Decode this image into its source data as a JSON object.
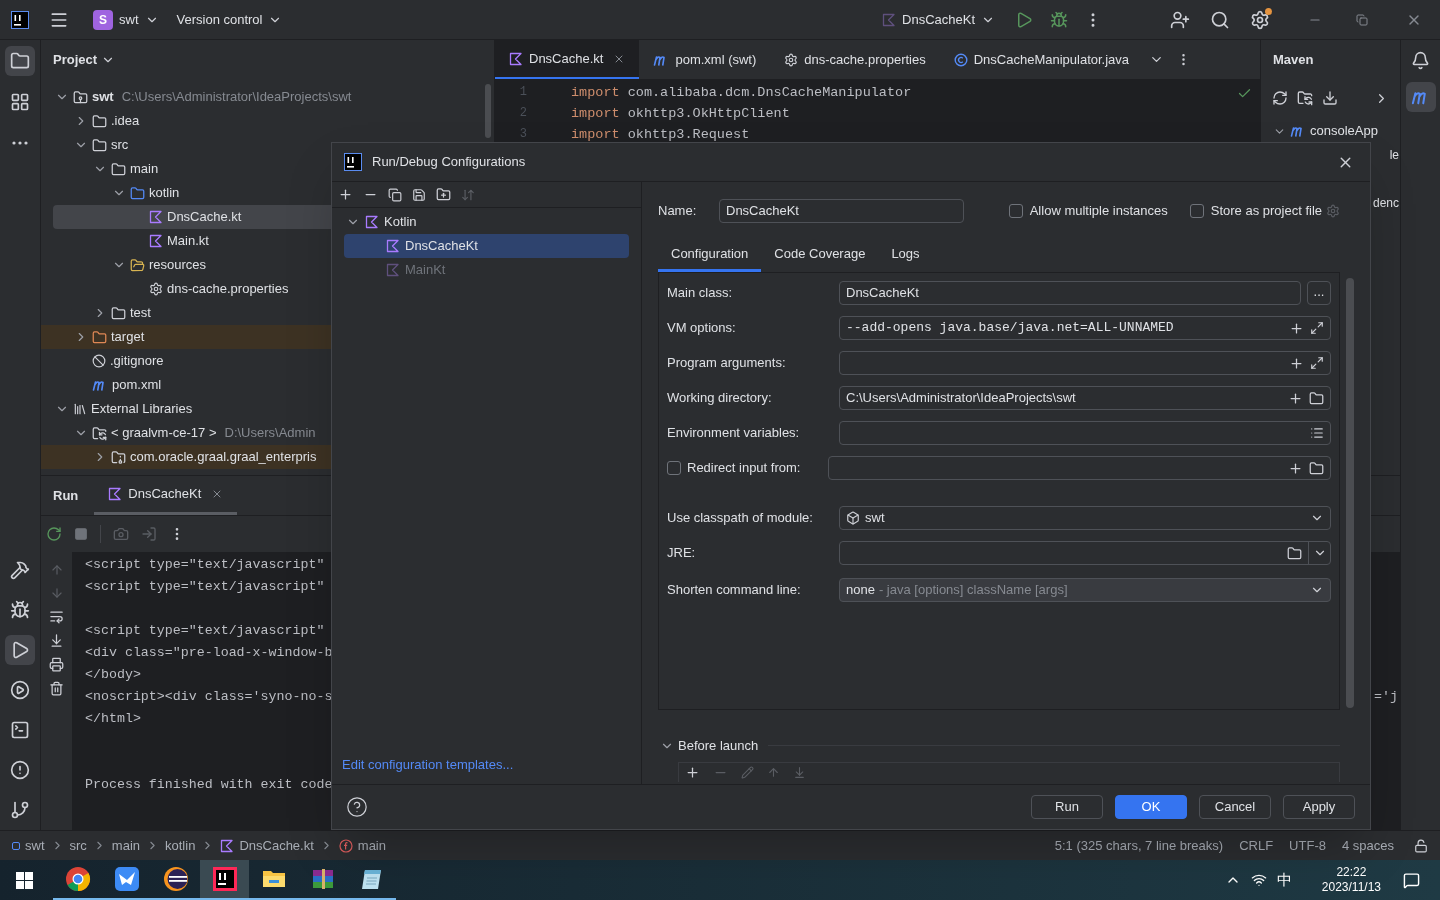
{
  "title_bar": {
    "project_initial": "S",
    "project": "swt",
    "vcs": "Version control",
    "run_config": "DnsCacheKt"
  },
  "left_toolbar": {
    "top": [
      {
        "kind": "project",
        "selected": true
      },
      {
        "kind": "structure",
        "selected": false
      },
      {
        "kind": "more",
        "selected": false
      }
    ],
    "bottom": [
      {
        "kind": "build",
        "selected": false
      },
      {
        "kind": "debug",
        "selected": false
      },
      {
        "kind": "run",
        "selected": true
      },
      {
        "kind": "services",
        "selected": false
      },
      {
        "kind": "terminal",
        "selected": false
      },
      {
        "kind": "problems",
        "selected": false
      },
      {
        "kind": "git",
        "selected": false
      }
    ]
  },
  "project": {
    "title": "Project",
    "tree": [
      {
        "label": "swt",
        "detail": "C:\\Users\\Administrator\\IdeaProjects\\swt",
        "kind": "project",
        "expanded": true,
        "selected": false,
        "highlighted": false,
        "children": [
          {
            "label": ".idea",
            "kind": "folder",
            "expanded": false,
            "selected": false,
            "highlighted": false
          },
          {
            "label": "src",
            "kind": "folder",
            "expanded": true,
            "selected": false,
            "highlighted": false,
            "children": [
              {
                "label": "main",
                "kind": "folder",
                "expanded": true,
                "selected": false,
                "highlighted": false,
                "children": [
                  {
                    "label": "kotlin",
                    "kind": "source",
                    "expanded": true,
                    "selected": false,
                    "highlighted": false,
                    "children": [
                      {
                        "label": "DnsCache.kt",
                        "kind": "kotlin",
                        "selected": true,
                        "highlighted": false
                      },
                      {
                        "label": "Main.kt",
                        "kind": "kotlin",
                        "selected": false,
                        "highlighted": false
                      }
                    ]
                  },
                  {
                    "label": "resources",
                    "kind": "resources",
                    "expanded": true,
                    "selected": false,
                    "highlighted": false,
                    "children": [
                      {
                        "label": "dns-cache.properties",
                        "kind": "properties",
                        "selected": false,
                        "highlighted": false
                      }
                    ]
                  }
                ]
              },
              {
                "label": "test",
                "kind": "folder",
                "expanded": false,
                "selected": false,
                "highlighted": false
              }
            ]
          },
          {
            "label": "target",
            "kind": "excluded",
            "expanded": false,
            "selected": false,
            "highlighted": true
          },
          {
            "label": ".gitignore",
            "kind": "ignore",
            "selected": false,
            "highlighted": false
          },
          {
            "label": "pom.xml",
            "kind": "maven",
            "selected": false,
            "highlighted": false
          }
        ]
      },
      {
        "label": "External Libraries",
        "kind": "libraries",
        "expanded": true,
        "selected": false,
        "highlighted": false,
        "children": [
          {
            "label": "< graalvm-ce-17 >",
            "detail": "D:\\Users\\Admin",
            "kind": "sdk",
            "expanded": true,
            "selected": false,
            "highlighted": false,
            "children": [
              {
                "label": "com.oracle.graal.graal_enterpris",
                "kind": "jar",
                "expanded": false,
                "selected": false,
                "highlighted": true
              }
            ]
          }
        ]
      }
    ]
  },
  "editor": {
    "tabs": [
      {
        "label": "DnsCache.kt",
        "kind": "kotlin",
        "selected": true
      },
      {
        "label": "pom.xml (swt)",
        "kind": "maven",
        "selected": false
      },
      {
        "label": "dns-cache.properties",
        "kind": "properties",
        "selected": false
      },
      {
        "label": "DnsCacheManipulator.java",
        "kind": "class",
        "selected": false
      }
    ],
    "lines": [
      {
        "number": "1",
        "keyword": "import",
        "text": "com.alibaba.dcm.DnsCacheManipulator"
      },
      {
        "number": "2",
        "keyword": "import",
        "text": "okhttp3.OkHttpClient"
      },
      {
        "number": "3",
        "keyword": "import",
        "text": "okhttp3.Request"
      }
    ]
  },
  "maven": {
    "title": "Maven",
    "tree": [
      {
        "label": "consoleApp",
        "expanded": true
      }
    ],
    "fragments": [
      "le",
      "denc"
    ]
  },
  "run_panel": {
    "title": "Run",
    "tabs": [
      {
        "label": "DnsCacheKt",
        "selected": true
      }
    ],
    "console": [
      {
        "kind": "line",
        "text": "<script type=\"text/javascript\""
      },
      {
        "kind": "line",
        "text": "<script type=\"text/javascript\""
      },
      {
        "kind": "blank"
      },
      {
        "kind": "line",
        "text": "<script type=\"text/javascript\""
      },
      {
        "kind": "line",
        "text": "<div class=\"pre-load-x-window-b"
      },
      {
        "kind": "line",
        "text": "</body>"
      },
      {
        "kind": "line",
        "text": "<noscript><div class='syno-no-s",
        "tail": "='j"
      },
      {
        "kind": "line",
        "text": "</html>"
      },
      {
        "kind": "blank"
      },
      {
        "kind": "blank"
      },
      {
        "kind": "line",
        "text": "Process finished with exit code"
      }
    ]
  },
  "dialog": {
    "title": "Run/Debug Configurations",
    "tree": [
      {
        "label": "Kotlin",
        "expanded": true,
        "selected": false,
        "dimmed": false,
        "children": [
          {
            "label": "DnsCacheKt",
            "selected": true,
            "dimmed": false
          },
          {
            "label": "MainKt",
            "selected": false,
            "dimmed": true
          }
        ]
      }
    ],
    "templates_link": "Edit configuration templates...",
    "name_label": "Name:",
    "name": "DnsCacheKt",
    "options": [
      {
        "label": "Allow multiple instances",
        "checked": false
      },
      {
        "label": "Store as project file",
        "checked": false
      }
    ],
    "tabs": [
      {
        "label": "Configuration",
        "selected": true
      },
      {
        "label": "Code Coverage",
        "selected": false
      },
      {
        "label": "Logs",
        "selected": false
      }
    ],
    "fields": [
      {
        "label": "Main class:",
        "kind": "class",
        "value": "DnsCacheKt",
        "button": "..."
      },
      {
        "label": "VM options:",
        "kind": "vm",
        "value": "--add-opens java.base/java.net=ALL-UNNAMED"
      },
      {
        "label": "Program arguments:",
        "kind": "expandable"
      },
      {
        "label": "Working directory:",
        "kind": "directory",
        "value": "C:\\Users\\Administrator\\IdeaProjects\\swt"
      },
      {
        "label": "Environment variables:",
        "kind": "env"
      },
      {
        "label": "Redirect input from:",
        "kind": "redirect",
        "checked": false
      },
      {
        "label": "Use classpath of module:",
        "kind": "module",
        "value": "swt"
      },
      {
        "label": "JRE:",
        "kind": "jre"
      },
      {
        "label": "Shorten command line:",
        "kind": "shorten",
        "value": "none",
        "hint": "- java [options] className [args]"
      }
    ],
    "before_launch": {
      "label": "Before launch",
      "expanded": true
    },
    "buttons": [
      {
        "label": "Run",
        "primary": false
      },
      {
        "label": "OK",
        "primary": true
      },
      {
        "label": "Cancel",
        "primary": false
      },
      {
        "label": "Apply",
        "primary": false
      }
    ]
  },
  "status_bar": {
    "breadcrumbs": [
      {
        "label": "swt",
        "kind": "module"
      },
      {
        "label": "src",
        "kind": "plain"
      },
      {
        "label": "main",
        "kind": "plain"
      },
      {
        "label": "kotlin",
        "kind": "plain"
      },
      {
        "label": "DnsCache.kt",
        "kind": "kotlin"
      },
      {
        "label": "main",
        "kind": "function"
      }
    ],
    "items": [
      "5:1 (325 chars, 7 line breaks)",
      "CRLF",
      "UTF-8",
      "4 spaces"
    ]
  },
  "taskbar": {
    "apps": [
      {
        "kind": "chrome",
        "selected": false
      },
      {
        "kind": "bird",
        "selected": false
      },
      {
        "kind": "eclipse",
        "selected": false
      },
      {
        "kind": "intellij",
        "selected": true
      },
      {
        "kind": "explorer",
        "selected": false
      },
      {
        "kind": "archive",
        "selected": false
      },
      {
        "kind": "notepad",
        "selected": false
      }
    ],
    "ime": "中",
    "time": "22:22",
    "date": "2023/11/13"
  }
}
